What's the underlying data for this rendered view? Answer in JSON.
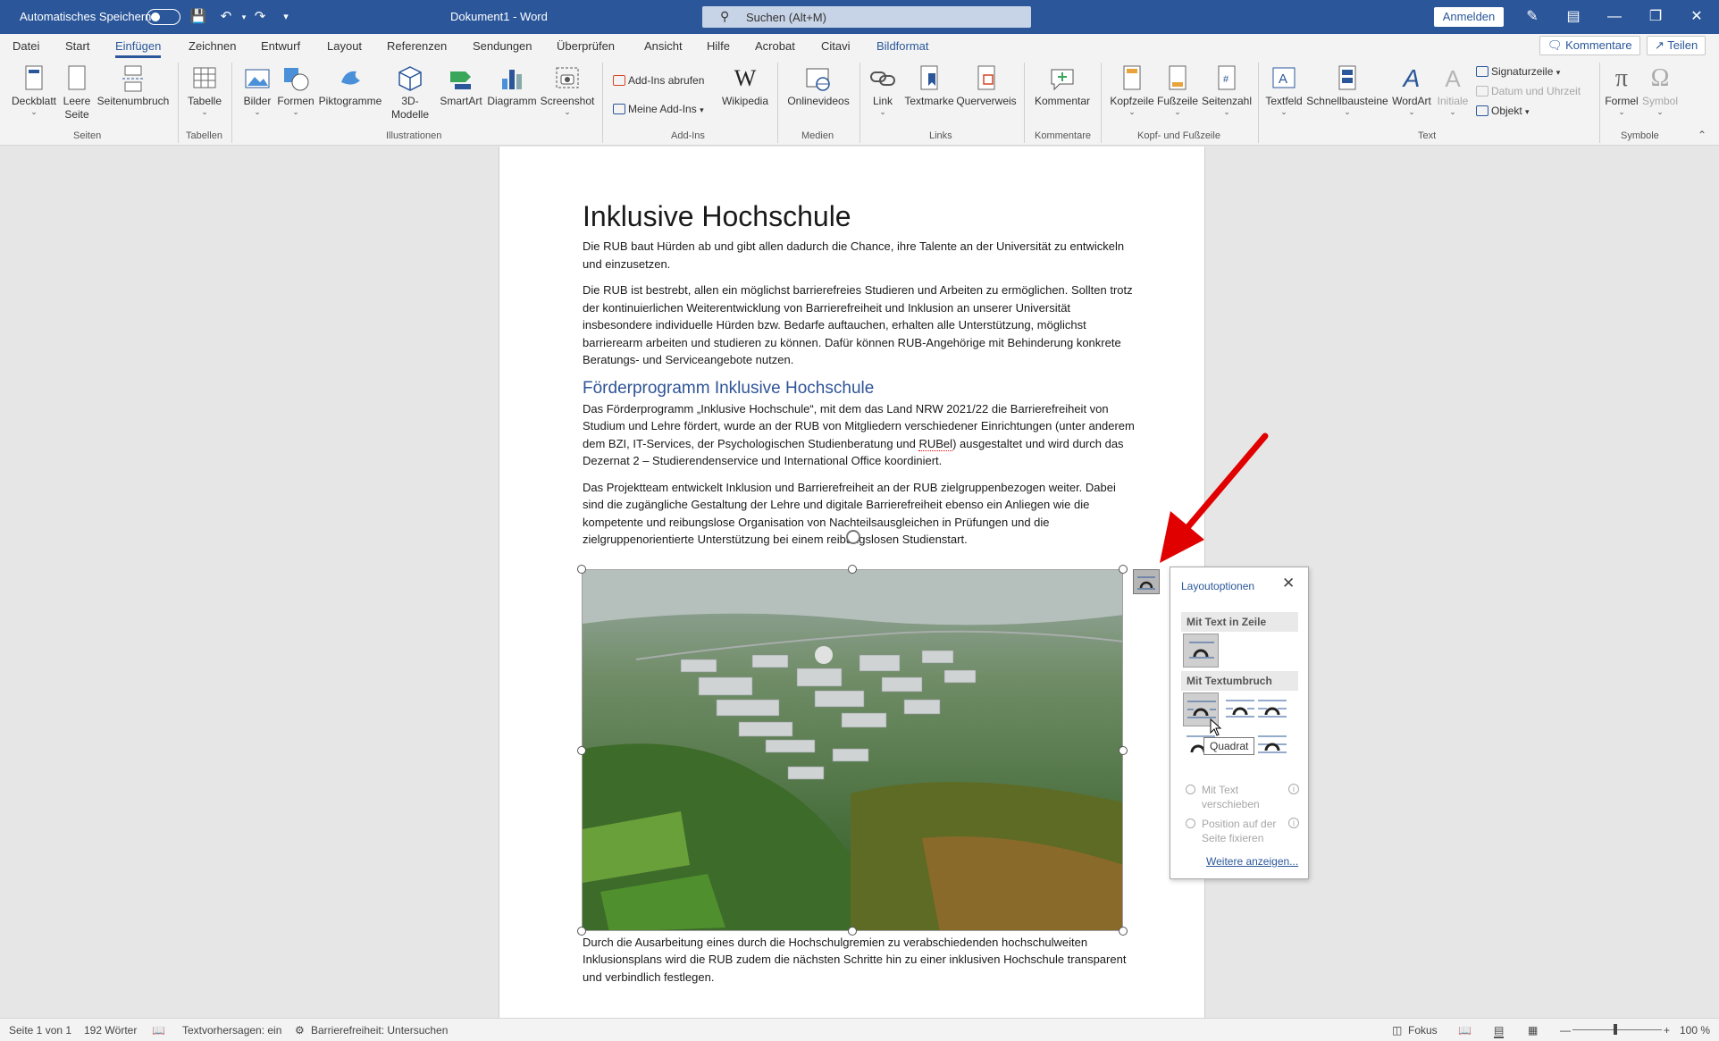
{
  "titlebar": {
    "autosave_label": "Automatisches Speichern",
    "document_title": "Dokument1 - Word",
    "search_placeholder": "Suchen (Alt+M)",
    "signin_label": "Anmelden"
  },
  "tabs": [
    "Datei",
    "Start",
    "Einfügen",
    "Zeichnen",
    "Entwurf",
    "Layout",
    "Referenzen",
    "Sendungen",
    "Überprüfen",
    "Ansicht",
    "Hilfe",
    "Acrobat",
    "Citavi",
    "Bildformat"
  ],
  "active_tab": "Einfügen",
  "tab_buttons": {
    "comments": "Kommentare",
    "share": "Teilen"
  },
  "ribbon": {
    "seiten": {
      "label": "Seiten",
      "items": [
        "Deckblatt",
        "Leere",
        "Seite",
        "Seitenumbruch"
      ]
    },
    "tabellen": {
      "label": "Tabellen",
      "items": [
        "Tabelle"
      ]
    },
    "illustrationen": {
      "label": "Illustrationen",
      "items": [
        "Bilder",
        "Formen",
        "Piktogramme",
        "3D-",
        "Modelle",
        "SmartArt",
        "Diagramm",
        "Screenshot"
      ]
    },
    "addins": {
      "label": "Add-Ins",
      "items": [
        "Add-Ins abrufen",
        "Meine Add-Ins",
        "Wikipedia"
      ]
    },
    "medien": {
      "label": "Medien",
      "items": [
        "Onlinevideos"
      ]
    },
    "links": {
      "label": "Links",
      "items": [
        "Link",
        "Textmarke",
        "Querverweis"
      ]
    },
    "kommentare": {
      "label": "Kommentare",
      "items": [
        "Kommentar"
      ]
    },
    "kopf": {
      "label": "Kopf- und Fußzeile",
      "items": [
        "Kopfzeile",
        "Fußzeile",
        "Seitenzahl"
      ]
    },
    "text": {
      "label": "Text",
      "items": [
        "Textfeld",
        "Schnellbausteine",
        "WordArt",
        "Initiale",
        "Signaturzeile",
        "Datum und Uhrzeit",
        "Objekt"
      ]
    },
    "symbole": {
      "label": "Symbole",
      "items": [
        "Formel",
        "Symbol"
      ]
    }
  },
  "document": {
    "title": "Inklusive Hochschule",
    "p1": "Die RUB baut Hürden ab und gibt allen dadurch die Chance, ihre Talente an der Universität zu entwickeln und einzusetzen.",
    "p2": "Die RUB ist bestrebt, allen ein möglichst barrierefreies Studieren und Arbeiten zu ermöglichen. Sollten trotz der kontinuierlichen Weiterentwicklung von Barrierefreiheit und Inklusion an unserer Universität insbesondere individuelle Hürden bzw. Bedarfe auftauchen, erhalten alle Unterstützung, möglichst barrierearm arbeiten und studieren zu können. Dafür können RUB-Angehörige mit Behinderung konkrete Beratungs- und Serviceangebote nutzen.",
    "heading2": "Förderprogramm Inklusive Hochschule",
    "p3a": "Das Förderprogramm „Inklusive Hochschule“, mit dem das Land NRW 2021/22 die Barrierefreiheit von Studium und Lehre fördert, wurde an der RUB von Mitgliedern verschiedener Einrichtungen (unter anderem dem BZI, IT-Services, der Psychologischen Studienberatung und ",
    "p3_squiggle": "RUBel",
    "p3b": ") ausgestaltet und wird durch das Dezernat 2 – Studierendenservice und International Office koordiniert.",
    "p4": "Das Projektteam entwickelt Inklusion und Barrierefreiheit an der RUB zielgruppenbezogen weiter. Dabei sind die zugängliche Gestaltung der Lehre und digitale Barrierefreiheit ebenso ein Anliegen wie die kompetente und reibungslose Organisation von Nachteilsausgleichen in Prüfungen und die zielgruppenorientierte Unterstützung bei einem reibungslosen Studienstart.",
    "p5": "Durch die Ausarbeitung eines durch die Hochschulgremien zu verabschiedenden hochschulweiten Inklusionsplans wird die RUB zudem die nächsten Schritte hin zu einer inklusiven Hochschule transparent und verbindlich festlegen."
  },
  "layout_panel": {
    "title": "Layoutoptionen",
    "section_inline": "Mit Text in Zeile",
    "section_wrap": "Mit Textumbruch",
    "tooltip": "Quadrat",
    "move_with_text": "Mit Text verschieben",
    "fix_position": "Position auf der Seite fixieren",
    "more_link": "Weitere anzeigen..."
  },
  "statusbar": {
    "page": "Seite 1 von 1",
    "words": "192 Wörter",
    "predictions": "Textvorhersagen: ein",
    "accessibility": "Barrierefreiheit: Untersuchen",
    "focus": "Fokus",
    "zoom": "100 %"
  },
  "colors": {
    "accent": "#2b579a",
    "heading": "#2f5496",
    "arrow": "#e00000"
  }
}
